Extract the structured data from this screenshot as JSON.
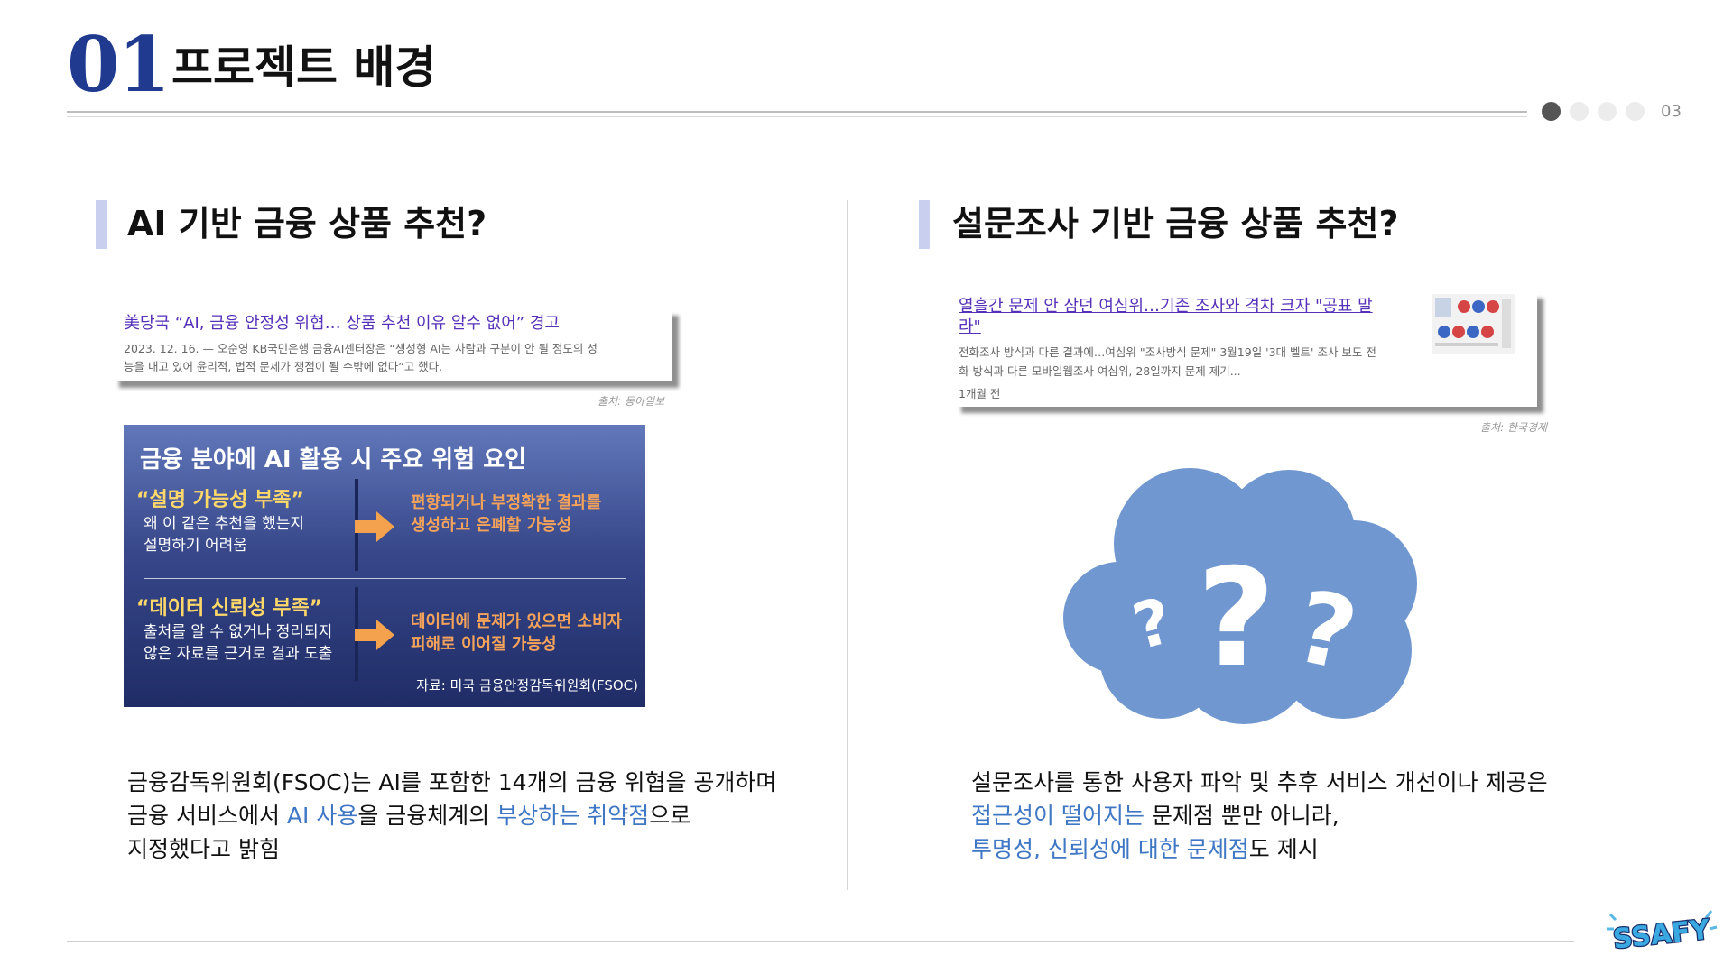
{
  "header": {
    "section_number": "01",
    "section_title": "프로젝트 배경",
    "page_number": "03",
    "page_dots": 4,
    "active_dot": 0
  },
  "left": {
    "heading": "AI 기반 금융 상품 추천?",
    "news": {
      "headline": "美당국 “AI, 금융 안정성 위협… 상품 추천 이유 알수 없어” 경고",
      "snippet_line1": "2023. 12. 16. — 오순영 KB국민은행 금융AI센터장은 “생성형 AI는 사람과 구분이 안 될 정도의 성",
      "snippet_line2": "능을 내고 있어 윤리적, 법적 문제가 쟁점이 될 수밖에 없다”고 했다.",
      "credit": "출처: 동아일보"
    },
    "infographic": {
      "title": "금융 분야에 AI 활용 시 주요 위험 요인",
      "risk1_heading": "“설명 가능성 부족”",
      "risk1_desc_line1": "왜 이 같은 추천을 했는지",
      "risk1_desc_line2": "설명하기 어려움",
      "risk1_result_line1": "편향되거나 부정확한 결과를",
      "risk1_result_line2": "생성하고 은폐할 가능성",
      "risk2_heading": "“데이터 신뢰성 부족”",
      "risk2_desc_line1": "출처를 알 수 없거나 정리되지",
      "risk2_desc_line2": "않은 자료를 근거로 결과 도출",
      "risk2_result_line1": "데이터에 문제가 있으면 소비자",
      "risk2_result_line2": "피해로 이어질 가능성",
      "source": "자료: 미국 금융안정감독위원회(FSOC)"
    },
    "body": {
      "line1": "금융감독위원회(FSOC)는 AI를 포함한 14개의 금융 위협을 공개하며",
      "line2_pre": "금융 서비스에서 ",
      "line2_hl1": "AI 사용",
      "line2_mid": "을 금융체계의 ",
      "line2_hl2": "부상하는 취약점",
      "line2_post": "으로",
      "line3": "지정했다고 밝힘"
    }
  },
  "right": {
    "heading": "설문조사 기반 금융 상품 추천?",
    "news": {
      "headline_line1": "열흘간 문제 안 삼던 여심위…기존 조사와 격차 크자 \"공표 말",
      "headline_line2": "라\"",
      "snippet_line1": "전화조사 방식과 다른 결과에…여심위 \"조사방식 문제\" 3월19일 '3대 벨트' 조사 보도 전",
      "snippet_line2": "화 방식과 다른 모바일웹조사 여심위, 28일까지 문제 제기...",
      "time": "1개월 전",
      "credit": "출처: 한국경제"
    },
    "cloud_color": "#7097cf",
    "body": {
      "line1": "설문조사를 통한 사용자 파악 및 추후 서비스 개선이나 제공은",
      "line2_hl": "접근성이 떨어지는",
      "line2_post": " 문제점 뿐만 아니라,",
      "line3_hl": "투명성, 신뢰성에 대한 문제점",
      "line3_post": "도 제시"
    }
  },
  "logo": {
    "text": "SSAFY"
  },
  "colors": {
    "accent": "#1f3a8f",
    "highlight": "#3f77c4",
    "bar": "#c9d0ef"
  }
}
